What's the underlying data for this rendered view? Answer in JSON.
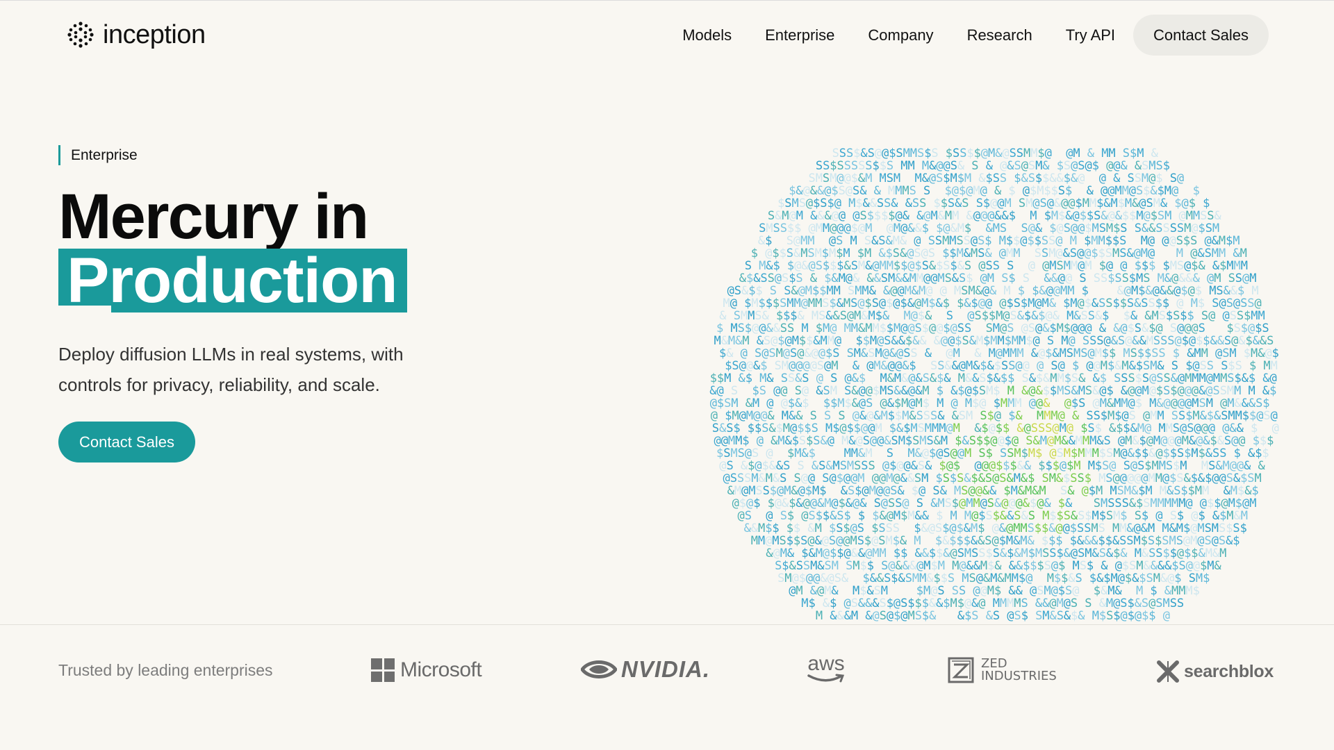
{
  "header": {
    "logo_text": "inception",
    "nav": [
      "Models",
      "Enterprise",
      "Company",
      "Research",
      "Try API"
    ],
    "cta_label": "Contact Sales"
  },
  "hero": {
    "eyebrow": "Enterprise",
    "title_line1": "Mercury in",
    "title_highlight": "Production",
    "subtitle": "Deploy diffusion LLMs in real systems, with controls for privacy, reliability, and scale.",
    "cta_label": "Contact Sales",
    "globe_characters": "M&S$@"
  },
  "trusted": {
    "label": "Trusted by leading enterprises",
    "logos": {
      "microsoft": "Microsoft",
      "nvidia": "NVIDIA.",
      "aws": "aws",
      "zed_line1": "ZED",
      "zed_line2": "INDUSTRIES",
      "searchblox": "searchblox"
    }
  },
  "colors": {
    "accent": "#1a9a9b",
    "background": "#f9f7f2",
    "nav_cta_bg": "#ecebe6",
    "logo_gray": "#6a6a6a"
  }
}
